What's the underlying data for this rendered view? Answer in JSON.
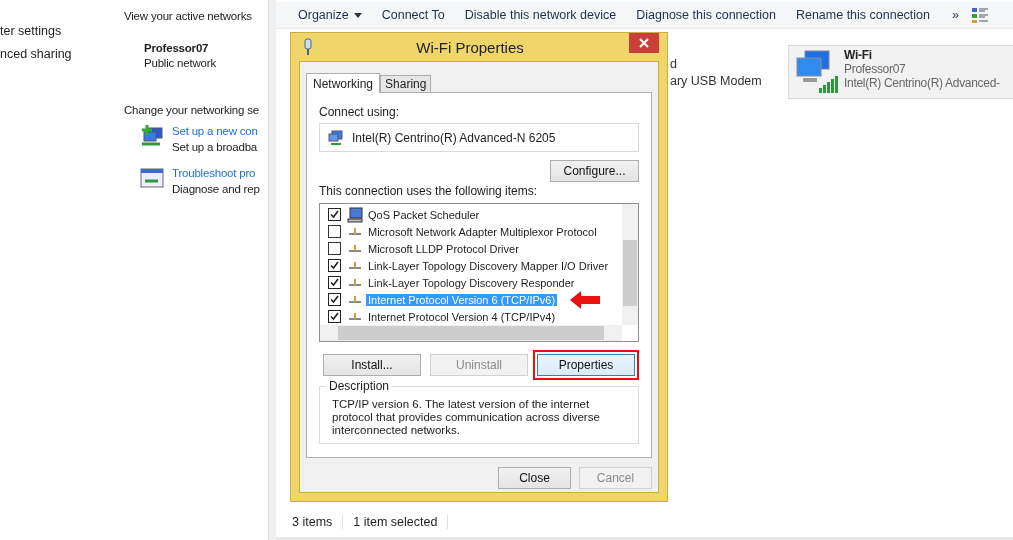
{
  "left_panel": {
    "links": [
      "ter settings",
      "nced sharing"
    ],
    "heading": "View your active networks",
    "network": {
      "name": "Professor07",
      "type": "Public network"
    },
    "section": "Change your networking se",
    "tasks": [
      {
        "kind": "setup",
        "link": "Set up a new con",
        "text": "Set up a broadba"
      },
      {
        "kind": "troubleshoot",
        "link": "Troubleshoot pro",
        "text": "Diagnose and rep"
      }
    ]
  },
  "toolbar": {
    "items": [
      "Organize",
      "Connect To",
      "Disable this network device",
      "Diagnose this connection",
      "Rename this connection"
    ],
    "more": "»"
  },
  "adapter_fragment": [
    "d",
    "ary USB Modem"
  ],
  "adapter": {
    "name": "Wi-Fi",
    "network": "Professor07",
    "device": "Intel(R) Centrino(R) Advanced-"
  },
  "status_bar": [
    "3 items",
    "1 item selected"
  ],
  "dialog": {
    "title": "Wi-Fi Properties",
    "tabs": [
      {
        "label": "Networking",
        "selected": true
      },
      {
        "label": "Sharing",
        "selected": false
      }
    ],
    "connect_using_label": "Connect using:",
    "device": "Intel(R) Centrino(R) Advanced-N 6205",
    "configure": "Configure...",
    "items_label": "This connection uses the following items:",
    "items": [
      {
        "label": "QoS Packet Scheduler",
        "kind": "service",
        "checked": true,
        "selected": false,
        "annotated": false
      },
      {
        "label": "Microsoft Network Adapter Multiplexor Protocol",
        "kind": "protocol",
        "checked": false,
        "selected": false,
        "annotated": false
      },
      {
        "label": "Microsoft LLDP Protocol Driver",
        "kind": "protocol",
        "checked": false,
        "selected": false,
        "annotated": false
      },
      {
        "label": "Link-Layer Topology Discovery Mapper I/O Driver",
        "kind": "protocol",
        "checked": true,
        "selected": false,
        "annotated": false
      },
      {
        "label": "Link-Layer Topology Discovery Responder",
        "kind": "protocol",
        "checked": true,
        "selected": false,
        "annotated": false
      },
      {
        "label": "Internet Protocol Version 6 (TCP/IPv6)",
        "kind": "protocol",
        "checked": true,
        "selected": true,
        "annotated": true
      },
      {
        "label": "Internet Protocol Version 4 (TCP/IPv4)",
        "kind": "protocol",
        "checked": true,
        "selected": false,
        "annotated": false
      }
    ],
    "item_buttons": [
      {
        "label": "Install...",
        "disabled": false,
        "annotated": false
      },
      {
        "label": "Uninstall",
        "disabled": true,
        "annotated": false
      },
      {
        "label": "Properties",
        "disabled": false,
        "annotated": true
      }
    ],
    "description_title": "Description",
    "description": "TCP/IP version 6. The latest version of the internet protocol that provides communication across diverse interconnected networks.",
    "buttons": [
      {
        "label": "Close",
        "disabled": false
      },
      {
        "label": "Cancel",
        "disabled": true
      }
    ]
  }
}
